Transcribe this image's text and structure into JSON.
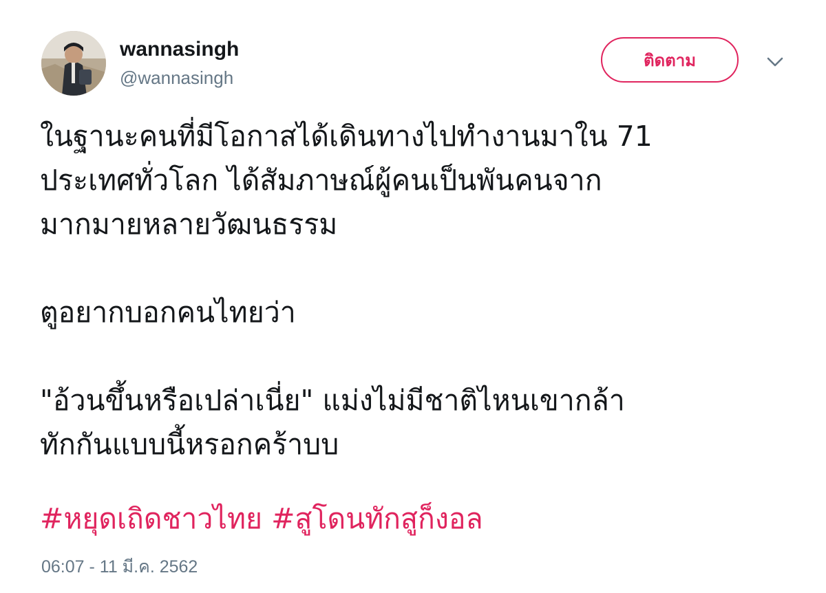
{
  "user": {
    "display_name": "wannasingh",
    "handle": "@wannasingh"
  },
  "follow_button": {
    "label": "ติดตาม"
  },
  "accent_color": "#e0245e",
  "icons": {
    "more": "chevron-down-icon",
    "avatar": "profile-photo"
  },
  "tweet": {
    "paragraph_1": [
      "ในฐานะคนที่มีโอกาสได้เดินทางไปทำงานมาใน 71",
      "ประเทศทั่วโลก ได้สัมภาษณ์ผู้คนเป็นพันคนจาก",
      "มากมายหลายวัฒนธรรม"
    ],
    "paragraph_2": [
      "ตูอยากบอกคนไทยว่า"
    ],
    "paragraph_3": [
      "\"อ้วนขึ้นหรือเปล่าเนี่ย\" แม่งไม่มีชาติไหนเขากล้า",
      "ทักกันแบบนี้หรอกคร้าบบ"
    ],
    "hashtags": [
      "#หยุดเถิดชาวไทย",
      "#สูโดนทักสูก็งอล"
    ],
    "timestamp": "06:07 - 11 มี.ค. 2562"
  }
}
